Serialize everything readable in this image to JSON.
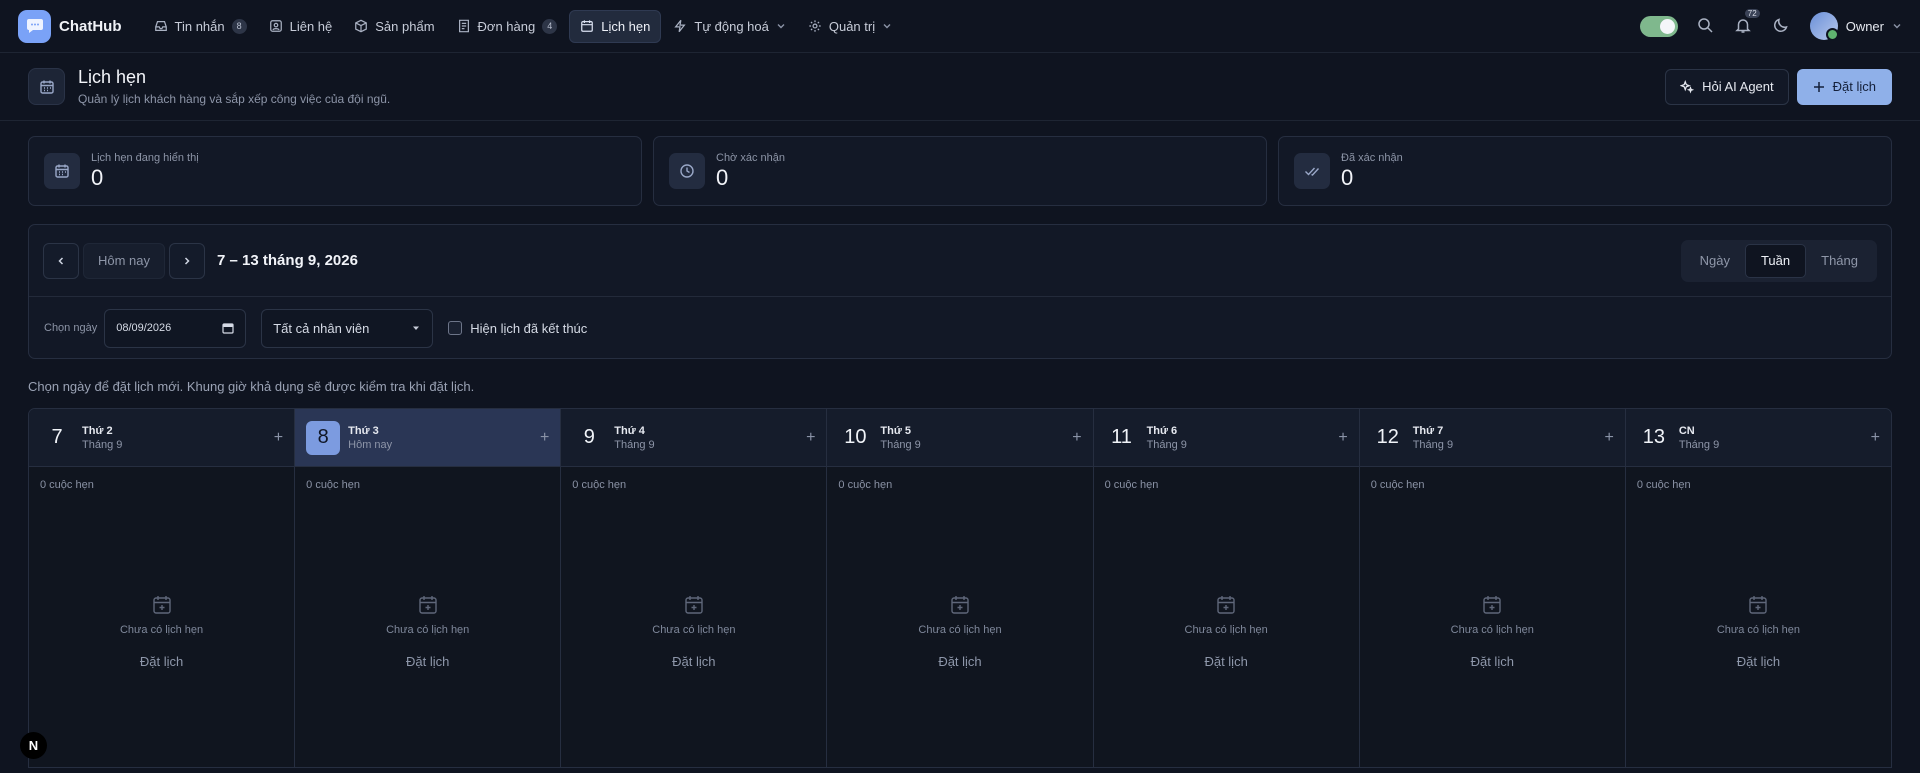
{
  "app": {
    "brand": "ChatHub"
  },
  "nav": [
    {
      "label": "Tin nhắn",
      "icon": "inbox-icon",
      "badge": "8",
      "active": false,
      "dropdown": false
    },
    {
      "label": "Liên hệ",
      "icon": "contact-icon",
      "badge": "",
      "active": false,
      "dropdown": false
    },
    {
      "label": "Sản phẩm",
      "icon": "box-icon",
      "badge": "",
      "active": false,
      "dropdown": false
    },
    {
      "label": "Đơn hàng",
      "icon": "receipt-icon",
      "badge": "4",
      "active": false,
      "dropdown": false
    },
    {
      "label": "Lịch hẹn",
      "icon": "calendar-icon",
      "badge": "",
      "active": true,
      "dropdown": false
    },
    {
      "label": "Tự động hoá",
      "icon": "bolt-icon",
      "badge": "",
      "active": false,
      "dropdown": true
    },
    {
      "label": "Quản trị",
      "icon": "gear-icon",
      "badge": "",
      "active": false,
      "dropdown": true
    }
  ],
  "topright": {
    "notif_badge": "72",
    "user": "Owner"
  },
  "page": {
    "title": "Lịch hẹn",
    "subtitle": "Quản lý lịch khách hàng và sắp xếp công việc của đội ngũ.",
    "ask_ai": "Hỏi AI Agent",
    "book": "Đặt lịch"
  },
  "stats": [
    {
      "label": "Lịch hẹn đang hiển thị",
      "value": "0",
      "icon": "calendar-icon"
    },
    {
      "label": "Chờ xác nhận",
      "value": "0",
      "icon": "clock-icon"
    },
    {
      "label": "Đã xác nhận",
      "value": "0",
      "icon": "double-check-icon"
    }
  ],
  "toolbar": {
    "today": "Hôm nay",
    "range": "7 – 13 tháng 9, 2026",
    "views": [
      "Ngày",
      "Tuần",
      "Tháng"
    ],
    "active_view": "Tuần",
    "date_label": "Chọn ngày",
    "date_value": "08/09/2026",
    "staff_select": "Tất cả nhân viên",
    "show_finished": "Hiện lịch đã kết thúc"
  },
  "hint": "Chọn ngày để đặt lịch mới. Khung giờ khả dụng sẽ được kiểm tra khi đặt lịch.",
  "days": [
    {
      "num": "7",
      "name": "Thứ 2",
      "sub": "Tháng 9",
      "count": "0 cuộc hẹn",
      "today": false
    },
    {
      "num": "8",
      "name": "Thứ 3",
      "sub": "Hôm nay",
      "count": "0 cuộc hẹn",
      "today": true
    },
    {
      "num": "9",
      "name": "Thứ 4",
      "sub": "Tháng 9",
      "count": "0 cuộc hẹn",
      "today": false
    },
    {
      "num": "10",
      "name": "Thứ 5",
      "sub": "Tháng 9",
      "count": "0 cuộc hẹn",
      "today": false
    },
    {
      "num": "11",
      "name": "Thứ 6",
      "sub": "Tháng 9",
      "count": "0 cuộc hẹn",
      "today": false
    },
    {
      "num": "12",
      "name": "Thứ 7",
      "sub": "Tháng 9",
      "count": "0 cuộc hẹn",
      "today": false
    },
    {
      "num": "13",
      "name": "CN",
      "sub": "Tháng 9",
      "count": "0 cuộc hẹn",
      "today": false
    }
  ],
  "empty": {
    "text": "Chưa có lịch hẹn",
    "action": "Đặt lịch"
  },
  "corner_badge": "N"
}
